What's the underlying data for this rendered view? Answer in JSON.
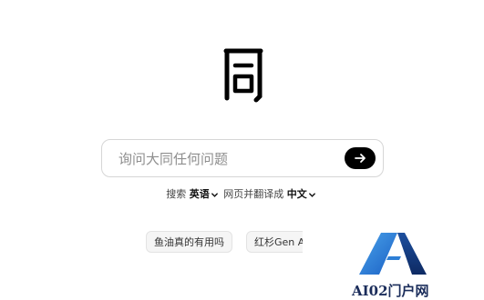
{
  "search": {
    "placeholder": "询问大同任何问题",
    "submit_icon": "arrow-right-icon"
  },
  "options": {
    "search_label": "搜索",
    "search_language": "英语",
    "translate_label": "网页并翻译成",
    "translate_language": "中文"
  },
  "suggestions": [
    "鱼油真的有用吗",
    "红杉Gen A"
  ],
  "watermark": {
    "text": "AI02门户网"
  },
  "colors": {
    "accent": "#000000",
    "watermark_blue": "#1f6fd0"
  }
}
